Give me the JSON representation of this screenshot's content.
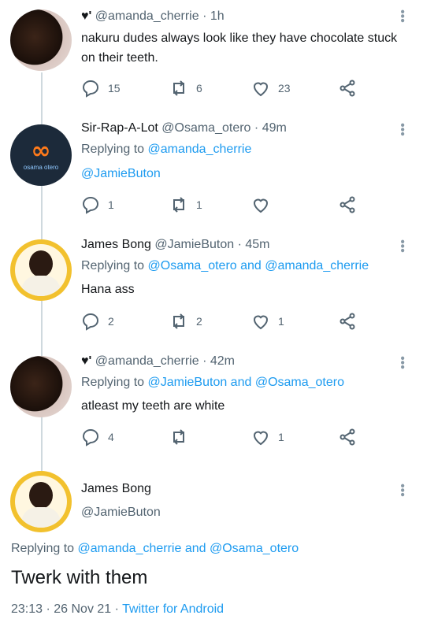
{
  "tweets": [
    {
      "name": "",
      "handle": "@amanda_cherrie",
      "time": "1h",
      "text": "nakuru dudes always look like they have chocolate stuck on their teeth.",
      "replying_prefix": "",
      "replying_to": "",
      "reply_count": "15",
      "retweet_count": "6",
      "like_count": "23"
    },
    {
      "name": "Sir-Rap-A-Lot",
      "handle": "@Osama_otero",
      "time": "49m",
      "replying_prefix": "Replying to",
      "replying_to": "@amanda_cherrie",
      "text": "@JamieButon",
      "reply_count": "1",
      "retweet_count": "1",
      "like_count": "",
      "avatar_label": "osama otero"
    },
    {
      "name": "James Bong",
      "handle": "@JamieButon",
      "time": "45m",
      "replying_prefix": "Replying to",
      "replying_to": "@Osama_otero and @amanda_cherrie",
      "text": "Hana ass",
      "reply_count": "2",
      "retweet_count": "2",
      "like_count": "1"
    },
    {
      "name": "",
      "handle": "@amanda_cherrie",
      "time": "42m",
      "replying_prefix": "Replying to",
      "replying_to": "@JamieButon and @Osama_otero",
      "text": "atleast my teeth are white",
      "reply_count": "4",
      "retweet_count": "",
      "like_count": "1"
    }
  ],
  "main_tweet": {
    "name": "James Bong",
    "handle": "@JamieButon",
    "replying_prefix": "Replying to",
    "replying_to": "@amanda_cherrie and @Osama_otero",
    "text": "Twerk with them",
    "timestamp": "23:13 · 26 Nov 21 · ",
    "source": "Twitter for Android"
  },
  "icons": {
    "reply": "reply-icon",
    "retweet": "retweet-icon",
    "like": "heart-icon",
    "share": "share-icon",
    "more": "more-vertical-icon",
    "badge": "heart-badge-icon"
  },
  "colors": {
    "link": "#1d9bf0",
    "secondary_text": "#536471",
    "thread_line": "#cfd9de"
  }
}
